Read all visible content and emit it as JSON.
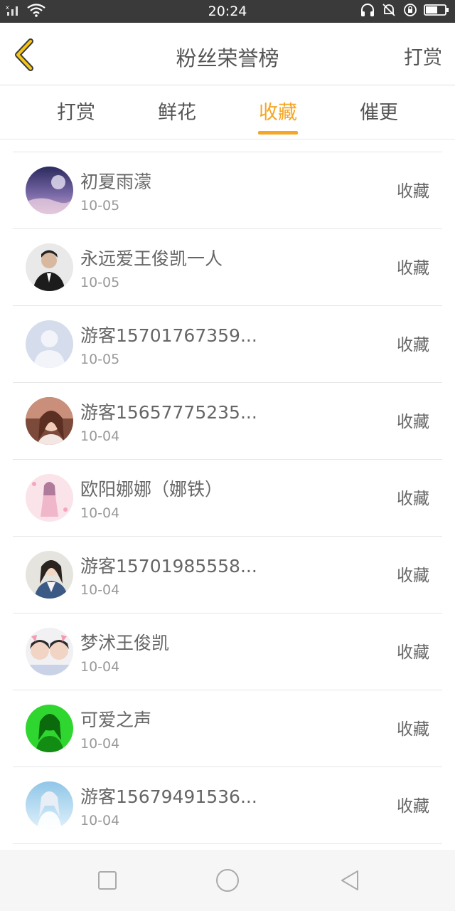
{
  "status_bar": {
    "time": "20:24",
    "left_icons": [
      "signal-icon",
      "wifi-icon"
    ],
    "right_icons": [
      "headphones-icon",
      "mute-bell-icon",
      "rotation-lock-icon",
      "battery-icon"
    ]
  },
  "nav": {
    "title": "粉丝荣誉榜",
    "right_action": "打赏",
    "back_icon": "chevron-left-icon"
  },
  "tabs": [
    {
      "label": "打赏",
      "active": false
    },
    {
      "label": "鲜花",
      "active": false
    },
    {
      "label": "收藏",
      "active": true
    },
    {
      "label": "催更",
      "active": false
    }
  ],
  "accent_color": "#f5a623",
  "list": [
    {
      "name": "初夏雨濛",
      "date": "10-05",
      "action": "收藏"
    },
    {
      "name": "永远爱王俊凯一人",
      "date": "10-05",
      "action": "收藏"
    },
    {
      "name": "游客15701767359...",
      "date": "10-05",
      "action": "收藏"
    },
    {
      "name": "游客15657775235...",
      "date": "10-04",
      "action": "收藏"
    },
    {
      "name": "欧阳娜娜（娜铁）",
      "date": "10-04",
      "action": "收藏"
    },
    {
      "name": "游客15701985558...",
      "date": "10-04",
      "action": "收藏"
    },
    {
      "name": "梦沭王俊凯",
      "date": "10-04",
      "action": "收藏"
    },
    {
      "name": "可爱之声",
      "date": "10-04",
      "action": "收藏"
    },
    {
      "name": "游客15679491536...",
      "date": "10-04",
      "action": "收藏"
    }
  ],
  "android_nav": [
    "recent-apps-icon",
    "home-icon",
    "back-triangle-icon"
  ]
}
